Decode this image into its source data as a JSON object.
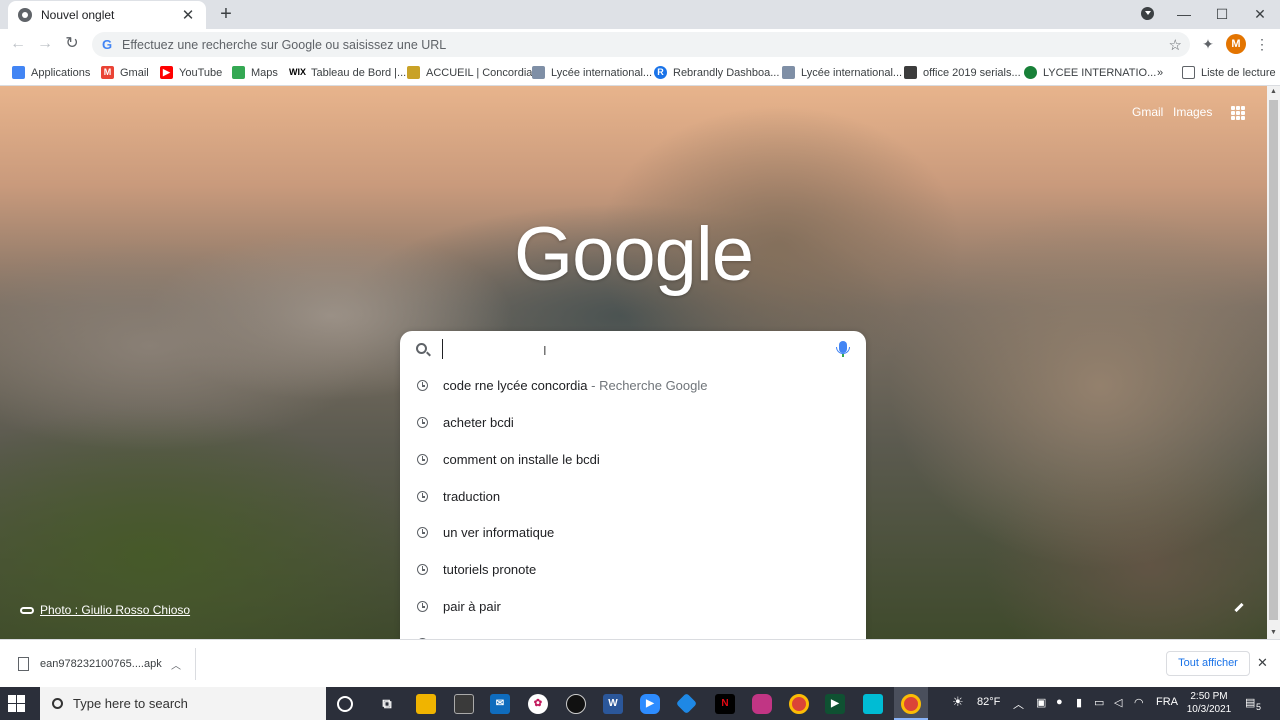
{
  "browser": {
    "tab_title": "Nouvel onglet",
    "omnibox_placeholder": "Effectuez une recherche sur Google ou saisissez une URL",
    "profile_initial": "M"
  },
  "bookmarks": [
    {
      "label": "Applications",
      "icon": "apps-grid-icon",
      "color": "#4285f4"
    },
    {
      "label": "Gmail",
      "icon": "gmail-icon",
      "color": "#ea4335"
    },
    {
      "label": "YouTube",
      "icon": "youtube-icon",
      "color": "#ff0000"
    },
    {
      "label": "Maps",
      "icon": "maps-icon",
      "color": "#34a853"
    },
    {
      "label": "Tableau de Bord |...",
      "icon": "wix-icon",
      "color": "#000000"
    },
    {
      "label": "ACCUEIL | Concordia",
      "icon": "concordia-icon",
      "color": "#c9a227"
    },
    {
      "label": "Lycée international...",
      "icon": "lycee-icon",
      "color": "#7f8fa6"
    },
    {
      "label": "Rebrandly Dashboa...",
      "icon": "rebrandly-icon",
      "color": "#1a73e8"
    },
    {
      "label": "Lycée international...",
      "icon": "lycee-icon",
      "color": "#7f8fa6"
    },
    {
      "label": "office 2019 serials...",
      "icon": "office-icon",
      "color": "#3c3c3c"
    },
    {
      "label": "LYCEE INTERNATIO...",
      "icon": "lycee-green-icon",
      "color": "#188038"
    }
  ],
  "bookmarks_more": "»",
  "reading_list": "Liste de lecture",
  "ntp": {
    "gmail_link": "Gmail",
    "images_link": "Images",
    "logo": "Google",
    "photo_credit": "Photo : Giulio Rosso Chioso"
  },
  "suggestions": [
    {
      "text": "code rne lycée concordia",
      "suffix": " - Recherche Google"
    },
    {
      "text": "acheter bcdi",
      "suffix": ""
    },
    {
      "text": "comment on installe le bcdi",
      "suffix": ""
    },
    {
      "text": "traduction",
      "suffix": ""
    },
    {
      "text": "un ver informatique",
      "suffix": ""
    },
    {
      "text": "tutoriels pronote",
      "suffix": ""
    },
    {
      "text": "pair à pair",
      "suffix": ""
    }
  ],
  "download": {
    "filename": "ean978232100765....apk",
    "show_all": "Tout afficher"
  },
  "taskbar": {
    "search_placeholder": "Type here to search",
    "weather": "82°F",
    "language": "FRA",
    "time": "2:50 PM",
    "date": "10/3/2021",
    "notifications": "5"
  }
}
